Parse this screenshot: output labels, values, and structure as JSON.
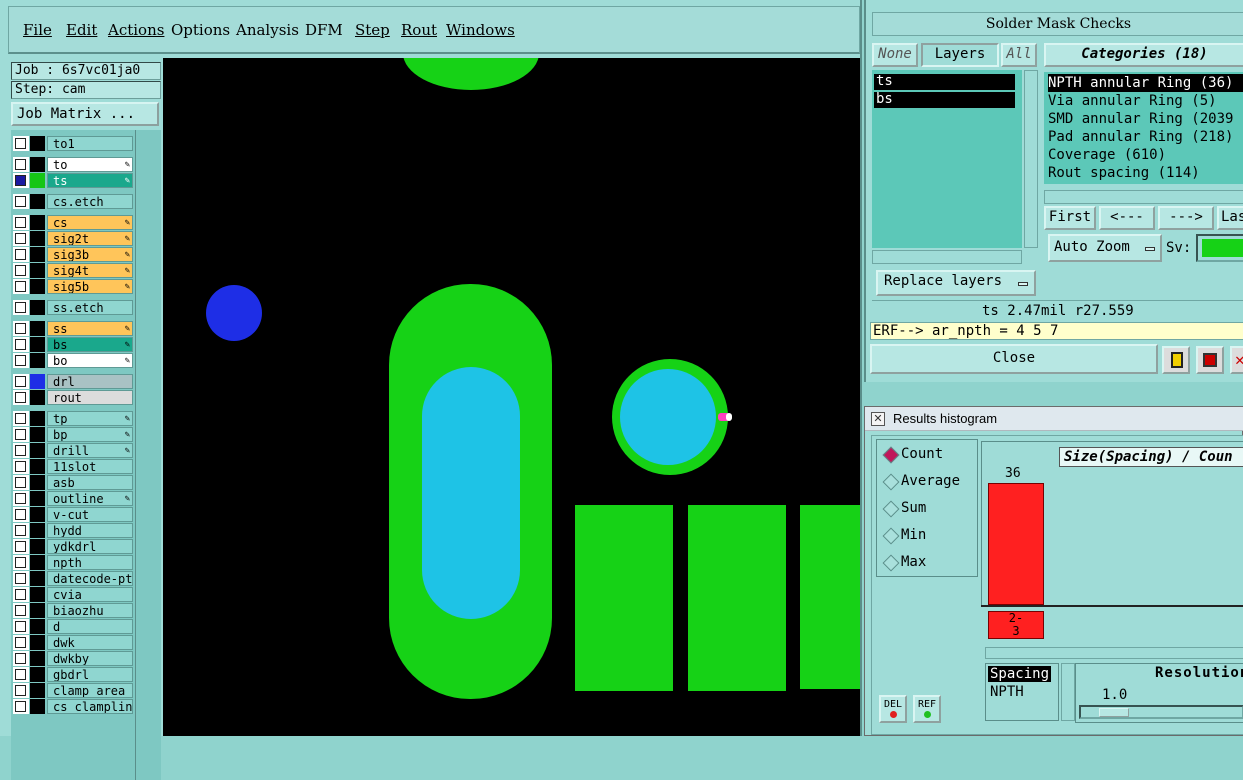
{
  "menubar": {
    "items": [
      {
        "label": "File",
        "underline": true
      },
      {
        "label": "Edit",
        "underline": true
      },
      {
        "label": "Actions",
        "underline": true
      },
      {
        "label": "Options",
        "underline": false
      },
      {
        "label": "Analysis",
        "underline": false
      },
      {
        "label": "DFM",
        "underline": false
      },
      {
        "label": "Step",
        "underline": true
      },
      {
        "label": "Rout",
        "underline": true
      },
      {
        "label": "Windows",
        "underline": true
      }
    ]
  },
  "job": {
    "job_label": "Job : 6s7vc01ja0",
    "step_label": "Step: cam",
    "matrix_button": "Job Matrix ..."
  },
  "layers": [
    {
      "name": "to1",
      "color": "#8fd6d0",
      "swatch": "#000000"
    },
    {
      "name": "to",
      "color": "#ffffff",
      "swatch": "#000000",
      "icon": "edit-icon"
    },
    {
      "name": "ts",
      "color": "#1aa88c",
      "swatch": "#16c616",
      "icon": "edit-icon",
      "active": true
    },
    {
      "name": "cs.etch",
      "color": "#8fd6d0",
      "swatch": "#000000"
    },
    {
      "name": "cs",
      "color": "#ffc55a",
      "swatch": "#000000",
      "icon": "edit-icon"
    },
    {
      "name": "sig2t",
      "color": "#ffc55a",
      "swatch": "#000000",
      "icon": "edit-icon"
    },
    {
      "name": "sig3b",
      "color": "#ffc55a",
      "swatch": "#000000",
      "icon": "edit-icon"
    },
    {
      "name": "sig4t",
      "color": "#ffc55a",
      "swatch": "#000000",
      "icon": "edit-icon"
    },
    {
      "name": "sig5b",
      "color": "#ffc55a",
      "swatch": "#000000",
      "icon": "edit-icon"
    },
    {
      "name": "ss.etch",
      "color": "#8fd6d0",
      "swatch": "#000000"
    },
    {
      "name": "ss",
      "color": "#ffc55a",
      "swatch": "#000000",
      "icon": "edit-icon"
    },
    {
      "name": "bs",
      "color": "#1aa88c",
      "swatch": "#000000",
      "icon": "edit-icon"
    },
    {
      "name": "bo",
      "color": "#ffffff",
      "swatch": "#000000",
      "icon": "edit-icon"
    },
    {
      "name": "drl",
      "color": "#a9c2c4",
      "swatch": "#1e2ee6"
    },
    {
      "name": "rout",
      "color": "#dcdcdc",
      "swatch": "#000000"
    },
    {
      "name": "tp",
      "color": "#8fd6d0",
      "swatch": "#000000",
      "icon": "edit-icon"
    },
    {
      "name": "bp",
      "color": "#8fd6d0",
      "swatch": "#000000",
      "icon": "edit-icon"
    },
    {
      "name": "drill",
      "color": "#8fd6d0",
      "swatch": "#000000",
      "icon": "edit-icon"
    },
    {
      "name": "11slot",
      "color": "#8fd6d0",
      "swatch": "#000000"
    },
    {
      "name": "asb",
      "color": "#8fd6d0",
      "swatch": "#000000"
    },
    {
      "name": "outline",
      "color": "#8fd6d0",
      "swatch": "#000000",
      "icon": "edit-icon"
    },
    {
      "name": "v-cut",
      "color": "#8fd6d0",
      "swatch": "#000000"
    },
    {
      "name": "hydd",
      "color": "#8fd6d0",
      "swatch": "#000000"
    },
    {
      "name": "ydkdrl",
      "color": "#8fd6d0",
      "swatch": "#000000"
    },
    {
      "name": "npth",
      "color": "#8fd6d0",
      "swatch": "#000000"
    },
    {
      "name": "datecode-pte",
      "color": "#8fd6d0",
      "swatch": "#000000"
    },
    {
      "name": "cvia",
      "color": "#8fd6d0",
      "swatch": "#000000"
    },
    {
      "name": "biaozhu",
      "color": "#8fd6d0",
      "swatch": "#000000"
    },
    {
      "name": "d",
      "color": "#8fd6d0",
      "swatch": "#000000"
    },
    {
      "name": "dwk",
      "color": "#8fd6d0",
      "swatch": "#000000"
    },
    {
      "name": "dwkby",
      "color": "#8fd6d0",
      "swatch": "#000000"
    },
    {
      "name": "gbdrl",
      "color": "#8fd6d0",
      "swatch": "#000000"
    },
    {
      "name": "clamp_area",
      "color": "#8fd6d0",
      "swatch": "#000000"
    },
    {
      "name": "cs_clampline",
      "color": "#8fd6d0",
      "swatch": "#000000"
    }
  ],
  "solder_mask": {
    "title": "Solder Mask Checks",
    "none_button": "None",
    "layers_tab": "Layers",
    "all_button": "All",
    "categories_tab": "Categories (18)",
    "layer_items": [
      "ts",
      "bs"
    ],
    "categories": [
      "NPTH annular Ring (36)",
      "Via annular Ring (5)",
      "SMD annular Ring (2039",
      "Pad annular Ring (218)",
      "Coverage (610)",
      "Rout spacing (114)"
    ],
    "first_button": "First",
    "prev_button": "<---",
    "next_button": "--->",
    "last_button": "Last",
    "auto_zoom": "Auto Zoom",
    "sv_label": "Sv:",
    "replace_layers": "Replace layers",
    "status": "ts 2.47mil  r27.559",
    "erf": "ERF--> ar_npth = 4 5 7",
    "close_button": "Close"
  },
  "histogram": {
    "window_title": "Results histogram",
    "modes": [
      "Count",
      "Average",
      "Sum",
      "Min",
      "Max"
    ],
    "selected_mode": "Count",
    "header": "Size(Spacing) / Coun",
    "bar_value_label": "36",
    "bar_value": 36,
    "bin_label_1": "2-",
    "bin_label_2": "3",
    "list_items": [
      "Spacing",
      "NPTH"
    ],
    "resolution_label": "Resolution",
    "resolution_value": "1.0",
    "del_button": "DEL",
    "ref_button": "REF"
  },
  "colors": {
    "background": "#9fdcd7",
    "pad_green": "#16d216",
    "hole_cyan": "#1ec3e6",
    "drill_blue": "#1e2ee6",
    "bar_red": "#ff2020"
  }
}
